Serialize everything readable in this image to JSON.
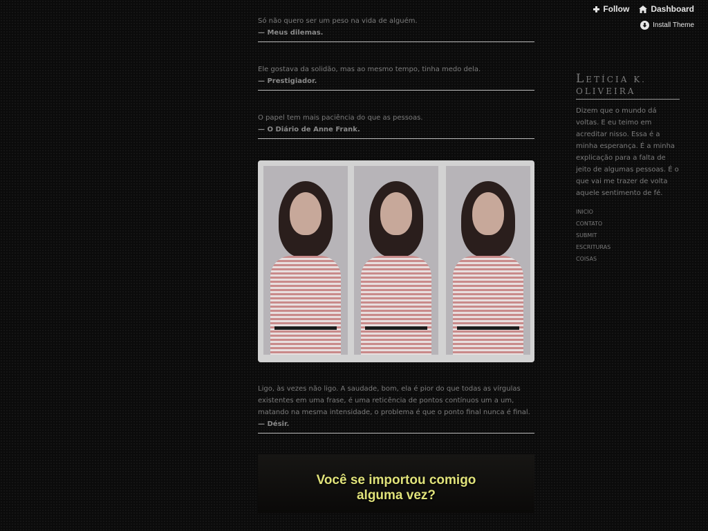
{
  "controls": {
    "follow_label": "Follow",
    "dashboard_label": "Dashboard",
    "install_theme_label": "Install Theme"
  },
  "posts": {
    "quote1": {
      "text": "Só não quero ser um peso na vida de alguém.",
      "source": "— Meus dilemas."
    },
    "quote2": {
      "text": "Ele gostava da solidão, mas ao mesmo tempo, tinha medo dela.",
      "source": "— Prestigiador."
    },
    "quote3": {
      "text": "O papel tem mais paciência do que as pessoas.",
      "source": "— O Diário de Anne Frank."
    },
    "quote4": {
      "text": "Ligo, às vezes não ligo. A saudade, bom, ela é pior do que todas as vírgulas existentes em uma frase, é uma reticência de pontos contínuos um a um, matando na mesma intensidade, o problema é que o ponto final nunca é final.",
      "source": "— Désir."
    },
    "video": {
      "caption_line1": "Você se importou comigo",
      "caption_line2": "alguma vez?"
    }
  },
  "sidebar": {
    "title_first_letter": "L",
    "title_rest": "etícia K. Oliveira",
    "description": "Dizem que o mundo dá voltas. E eu teimo em acreditar nisso. Essa é a minha esperança. É a minha explicação para a falta de jeito de algumas pessoas. É o que vai me trazer de volta aquele sentimento de fé.",
    "nav": [
      "Inicio",
      "Contato",
      "Submit",
      "Escrituras",
      "Coisas"
    ]
  }
}
